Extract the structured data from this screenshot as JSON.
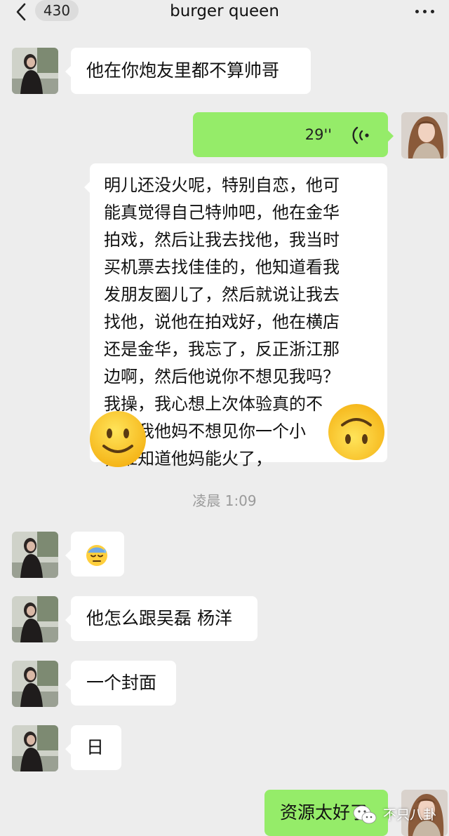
{
  "header": {
    "unread_count": "430",
    "title": "burger queen",
    "back_icon": "chevron-left-icon",
    "more_icon": "more-dots-icon"
  },
  "colors": {
    "background": "#ededed",
    "incoming_bubble": "#ffffff",
    "outgoing_bubble": "#95ec69",
    "timestamp": "#9a9a9a"
  },
  "messages": [
    {
      "side": "in",
      "text": "他在你炮友里都不算帅哥"
    },
    {
      "side": "out",
      "type": "voice",
      "duration": "29''",
      "icon": "voice-wave-icon"
    },
    {
      "side": "in",
      "text": "明儿还没火呢，特别自恋，他可\n能真觉得自己特帅吧，他在金华\n拍戏，然后让我去找他，我当时\n买机票去找佳佳的，他知道看我\n发朋友圈儿了，然后就说让我去\n找他，说他在拍戏好，他在横店\n还是金华，我忘了，反正浙江那\n边啊，然后他说你不想见我吗？\n我操，我心想上次体验真的不\n好，我他妈不想见你一个小\n，谁知道他妈能火了，"
    },
    {
      "side": "in",
      "type": "emoji",
      "icon": "sweat-face-icon"
    },
    {
      "side": "in",
      "text": "他怎么跟吴磊 杨洋"
    },
    {
      "side": "in",
      "text": "一个封面"
    },
    {
      "side": "in",
      "text": "日"
    },
    {
      "side": "out",
      "text": "资源太好了"
    }
  ],
  "stickers": {
    "left": "smiling-face-icon",
    "right": "upside-down-face-icon"
  },
  "timestamp": "凌晨 1:09",
  "watermark": {
    "text": "不只八卦",
    "icon": "wechat-logo-icon"
  }
}
